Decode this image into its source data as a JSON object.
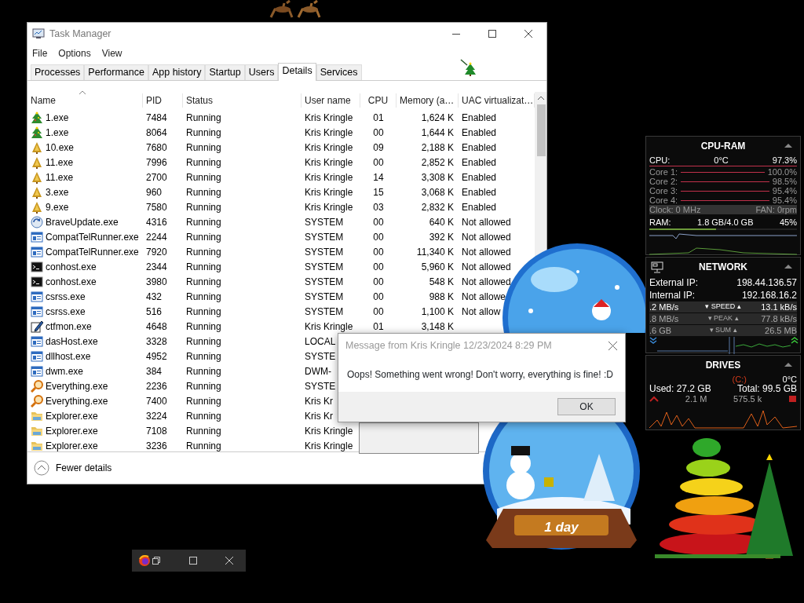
{
  "task_manager": {
    "title": "Task Manager",
    "menu": [
      "File",
      "Options",
      "View"
    ],
    "tabs": [
      {
        "label": "Processes",
        "selected": false
      },
      {
        "label": "Performance",
        "selected": false
      },
      {
        "label": "App history",
        "selected": false
      },
      {
        "label": "Startup",
        "selected": false
      },
      {
        "label": "Users",
        "selected": false
      },
      {
        "label": "Details",
        "selected": true
      },
      {
        "label": "Services",
        "selected": false
      }
    ],
    "columns": [
      "Name",
      "PID",
      "Status",
      "User name",
      "CPU",
      "Memory (a…",
      "UAC virtualizat…"
    ],
    "rows": [
      {
        "kind": "tree",
        "name": "1.exe",
        "pid": "7484",
        "status": "Running",
        "user": "Kris Kringle",
        "cpu": "01",
        "memory": "1,624 K",
        "uac": "Enabled"
      },
      {
        "kind": "tree",
        "name": "1.exe",
        "pid": "8064",
        "status": "Running",
        "user": "Kris Kringle",
        "cpu": "00",
        "memory": "1,644 K",
        "uac": "Enabled"
      },
      {
        "kind": "cone",
        "name": "10.exe",
        "pid": "7680",
        "status": "Running",
        "user": "Kris Kringle",
        "cpu": "09",
        "memory": "2,188 K",
        "uac": "Enabled"
      },
      {
        "kind": "cone",
        "name": "11.exe",
        "pid": "7996",
        "status": "Running",
        "user": "Kris Kringle",
        "cpu": "00",
        "memory": "2,852 K",
        "uac": "Enabled"
      },
      {
        "kind": "cone",
        "name": "11.exe",
        "pid": "2700",
        "status": "Running",
        "user": "Kris Kringle",
        "cpu": "14",
        "memory": "3,308 K",
        "uac": "Enabled"
      },
      {
        "kind": "cone",
        "name": "3.exe",
        "pid": "960",
        "status": "Running",
        "user": "Kris Kringle",
        "cpu": "15",
        "memory": "3,068 K",
        "uac": "Enabled"
      },
      {
        "kind": "cone",
        "name": "9.exe",
        "pid": "7580",
        "status": "Running",
        "user": "Kris Kringle",
        "cpu": "03",
        "memory": "2,832 K",
        "uac": "Enabled"
      },
      {
        "kind": "updater",
        "name": "BraveUpdate.exe",
        "pid": "4316",
        "status": "Running",
        "user": "SYSTEM",
        "cpu": "00",
        "memory": "640 K",
        "uac": "Not allowed"
      },
      {
        "kind": "service",
        "name": "CompatTelRunner.exe",
        "pid": "2244",
        "status": "Running",
        "user": "SYSTEM",
        "cpu": "00",
        "memory": "392 K",
        "uac": "Not allowed"
      },
      {
        "kind": "service",
        "name": "CompatTelRunner.exe",
        "pid": "7920",
        "status": "Running",
        "user": "SYSTEM",
        "cpu": "00",
        "memory": "11,340 K",
        "uac": "Not allowed"
      },
      {
        "kind": "console",
        "name": "conhost.exe",
        "pid": "2344",
        "status": "Running",
        "user": "SYSTEM",
        "cpu": "00",
        "memory": "5,960 K",
        "uac": "Not allowed"
      },
      {
        "kind": "console",
        "name": "conhost.exe",
        "pid": "3980",
        "status": "Running",
        "user": "SYSTEM",
        "cpu": "00",
        "memory": "548 K",
        "uac": "Not allowed"
      },
      {
        "kind": "service",
        "name": "csrss.exe",
        "pid": "432",
        "status": "Running",
        "user": "SYSTEM",
        "cpu": "00",
        "memory": "988 K",
        "uac": "Not allowe"
      },
      {
        "kind": "service",
        "name": "csrss.exe",
        "pid": "516",
        "status": "Running",
        "user": "SYSTEM",
        "cpu": "00",
        "memory": "1,100 K",
        "uac": "Not allow"
      },
      {
        "kind": "editor",
        "name": "ctfmon.exe",
        "pid": "4648",
        "status": "Running",
        "user": "Kris Kringle",
        "cpu": "01",
        "memory": "3,148 K"
      },
      {
        "kind": "service",
        "name": "dasHost.exe",
        "pid": "3328",
        "status": "Running",
        "user": "LOCAL"
      },
      {
        "kind": "service",
        "name": "dllhost.exe",
        "pid": "4952",
        "status": "Running",
        "user": "SYSTE"
      },
      {
        "kind": "service",
        "name": "dwm.exe",
        "pid": "384",
        "status": "Running",
        "user": "DWM-"
      },
      {
        "kind": "search",
        "name": "Everything.exe",
        "pid": "2236",
        "status": "Running",
        "user": "SYSTE"
      },
      {
        "kind": "search",
        "name": "Everything.exe",
        "pid": "7400",
        "status": "Running",
        "user": "Kris Kr"
      },
      {
        "kind": "explorer",
        "name": "Explorer.exe",
        "pid": "3224",
        "status": "Running",
        "user": "Kris Kr"
      },
      {
        "kind": "explorer",
        "name": "Explorer.exe",
        "pid": "7108",
        "status": "Running",
        "user": "Kris Kringle"
      },
      {
        "kind": "explorer",
        "name": "Explorer.exe",
        "pid": "3236",
        "status": "Running",
        "user": "Kris Kringle"
      }
    ],
    "footer": "Fewer details"
  },
  "dialog": {
    "title": "Message from Kris Kringle 12/23/2024 8:29 PM",
    "message": "Oops! Something went wrong! Don't worry, everything is fine! :D",
    "button": "OK"
  },
  "gadget": {
    "cpu_ram": {
      "title": "CPU-RAM",
      "cpu_label": "CPU:",
      "temp": "0°C",
      "cpu_value": "97.3%",
      "cores": [
        {
          "label": "Core 1:",
          "value": "100.0%"
        },
        {
          "label": "Core 2:",
          "value": "98.5%"
        },
        {
          "label": "Core 3:",
          "value": "95.4%"
        },
        {
          "label": "Core 4:",
          "value": "95.4%"
        }
      ],
      "clock": "Clock: 0 MHz",
      "fan": "FAN: 0rpm",
      "ram": {
        "label": "RAM:",
        "usage": "1.8 GB/4.0 GB",
        "value": "45%",
        "level": 0.45
      }
    },
    "network": {
      "title": "NETWORK",
      "external_label": "External IP:",
      "external_ip": "198.44.136.57",
      "internal_label": "Internal IP:",
      "internal_ip": "192.168.16.2",
      "stats": [
        {
          "down": ".2 MB/s",
          "label": "▾ SPEED ▴",
          "up": "13.1 kB/s"
        },
        {
          "down": ".8 MB/s",
          "label": "▾ PEAK ▴",
          "up": "77.8 kB/s"
        },
        {
          "down": ".6 GB",
          "label": "▾ SUM ▴",
          "up": "26.5 MB"
        }
      ]
    },
    "drives": {
      "title": "DRIVES",
      "drive": "(C:)",
      "temp": "0°C",
      "used": "Used: 27.2 GB",
      "total": "Total: 99.5 GB",
      "read": "2.1 M",
      "write": "575.5 k"
    }
  },
  "countdown": "1 day"
}
